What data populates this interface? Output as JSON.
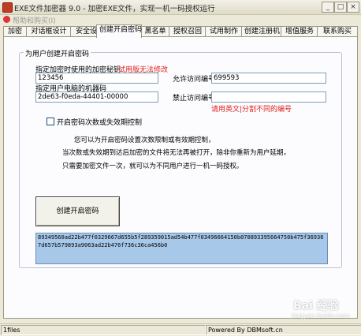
{
  "window": {
    "title": "EXE文件加密器 9.0 - 加密EXE文件，实现一机一码授权运行",
    "min": "_",
    "max": "□",
    "close": "×"
  },
  "menubar": {
    "item": "帮助和购买(I)"
  },
  "tabs": [
    {
      "label": "加密"
    },
    {
      "label": "对话框设计"
    },
    {
      "label": "安全设置"
    },
    {
      "label": "创建开启密码"
    },
    {
      "label": "黑名单"
    },
    {
      "label": "授权召回"
    },
    {
      "label": "试用制作"
    },
    {
      "label": "创建注册机"
    },
    {
      "label": "增值服务"
    },
    {
      "label": "联系购买"
    }
  ],
  "form": {
    "group_title": "为用户创建开启密码",
    "key_label": "指定加密时使用的加密秘钥",
    "key_note": "试用版无法修改",
    "key_value": "123456",
    "machine_label": "指定用户电脑的机器码",
    "machine_value": "2de63-f0eda-44401-00000",
    "allow_label": "允许访问编号",
    "allow_value": "699593",
    "deny_label": "禁止访问编号",
    "deny_value": "",
    "deny_hint": "请用英文|分割不同的编号",
    "checkbox_label": "开启密码次数或失效期控制"
  },
  "info": {
    "line1": "您可以为开启密码设置次数限制或有效期控制，",
    "line2": "当次数或失效期到达后加密的文件将无法再被打开，除非你重新为用户延期，",
    "line3": "只需要加密文件一次，就可以为不同用户进行一机一码授权。"
  },
  "create_button": "创建开启密码",
  "output_code": "89349560ad22b477f0329667d655b5f289359015ad54b477f03496664150b070893395664750b475f369367d657b579893a9063ad22b476f736c36ca456b0",
  "status": {
    "left": "1files",
    "right": "Powered By DBMsoft.cn"
  },
  "watermark": {
    "text": "Bai 经验",
    "url": "jingyan.baidu.com"
  }
}
